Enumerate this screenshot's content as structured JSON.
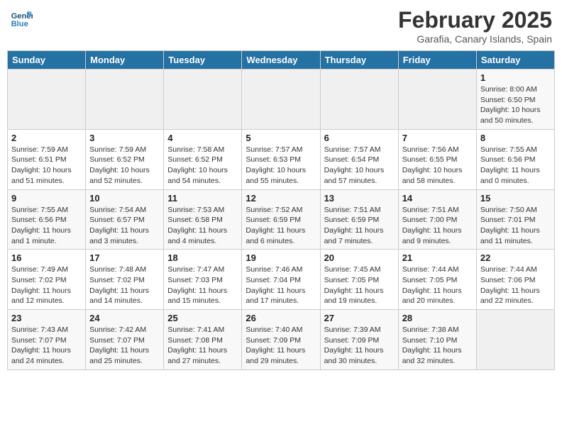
{
  "header": {
    "logo_line1": "General",
    "logo_line2": "Blue",
    "month": "February 2025",
    "location": "Garafia, Canary Islands, Spain"
  },
  "weekdays": [
    "Sunday",
    "Monday",
    "Tuesday",
    "Wednesday",
    "Thursday",
    "Friday",
    "Saturday"
  ],
  "weeks": [
    [
      {
        "day": "",
        "info": ""
      },
      {
        "day": "",
        "info": ""
      },
      {
        "day": "",
        "info": ""
      },
      {
        "day": "",
        "info": ""
      },
      {
        "day": "",
        "info": ""
      },
      {
        "day": "",
        "info": ""
      },
      {
        "day": "1",
        "info": "Sunrise: 8:00 AM\nSunset: 6:50 PM\nDaylight: 10 hours\nand 50 minutes."
      }
    ],
    [
      {
        "day": "2",
        "info": "Sunrise: 7:59 AM\nSunset: 6:51 PM\nDaylight: 10 hours\nand 51 minutes."
      },
      {
        "day": "3",
        "info": "Sunrise: 7:59 AM\nSunset: 6:52 PM\nDaylight: 10 hours\nand 52 minutes."
      },
      {
        "day": "4",
        "info": "Sunrise: 7:58 AM\nSunset: 6:52 PM\nDaylight: 10 hours\nand 54 minutes."
      },
      {
        "day": "5",
        "info": "Sunrise: 7:57 AM\nSunset: 6:53 PM\nDaylight: 10 hours\nand 55 minutes."
      },
      {
        "day": "6",
        "info": "Sunrise: 7:57 AM\nSunset: 6:54 PM\nDaylight: 10 hours\nand 57 minutes."
      },
      {
        "day": "7",
        "info": "Sunrise: 7:56 AM\nSunset: 6:55 PM\nDaylight: 10 hours\nand 58 minutes."
      },
      {
        "day": "8",
        "info": "Sunrise: 7:55 AM\nSunset: 6:56 PM\nDaylight: 11 hours\nand 0 minutes."
      }
    ],
    [
      {
        "day": "9",
        "info": "Sunrise: 7:55 AM\nSunset: 6:56 PM\nDaylight: 11 hours\nand 1 minute."
      },
      {
        "day": "10",
        "info": "Sunrise: 7:54 AM\nSunset: 6:57 PM\nDaylight: 11 hours\nand 3 minutes."
      },
      {
        "day": "11",
        "info": "Sunrise: 7:53 AM\nSunset: 6:58 PM\nDaylight: 11 hours\nand 4 minutes."
      },
      {
        "day": "12",
        "info": "Sunrise: 7:52 AM\nSunset: 6:59 PM\nDaylight: 11 hours\nand 6 minutes."
      },
      {
        "day": "13",
        "info": "Sunrise: 7:51 AM\nSunset: 6:59 PM\nDaylight: 11 hours\nand 7 minutes."
      },
      {
        "day": "14",
        "info": "Sunrise: 7:51 AM\nSunset: 7:00 PM\nDaylight: 11 hours\nand 9 minutes."
      },
      {
        "day": "15",
        "info": "Sunrise: 7:50 AM\nSunset: 7:01 PM\nDaylight: 11 hours\nand 11 minutes."
      }
    ],
    [
      {
        "day": "16",
        "info": "Sunrise: 7:49 AM\nSunset: 7:02 PM\nDaylight: 11 hours\nand 12 minutes."
      },
      {
        "day": "17",
        "info": "Sunrise: 7:48 AM\nSunset: 7:02 PM\nDaylight: 11 hours\nand 14 minutes."
      },
      {
        "day": "18",
        "info": "Sunrise: 7:47 AM\nSunset: 7:03 PM\nDaylight: 11 hours\nand 15 minutes."
      },
      {
        "day": "19",
        "info": "Sunrise: 7:46 AM\nSunset: 7:04 PM\nDaylight: 11 hours\nand 17 minutes."
      },
      {
        "day": "20",
        "info": "Sunrise: 7:45 AM\nSunset: 7:05 PM\nDaylight: 11 hours\nand 19 minutes."
      },
      {
        "day": "21",
        "info": "Sunrise: 7:44 AM\nSunset: 7:05 PM\nDaylight: 11 hours\nand 20 minutes."
      },
      {
        "day": "22",
        "info": "Sunrise: 7:44 AM\nSunset: 7:06 PM\nDaylight: 11 hours\nand 22 minutes."
      }
    ],
    [
      {
        "day": "23",
        "info": "Sunrise: 7:43 AM\nSunset: 7:07 PM\nDaylight: 11 hours\nand 24 minutes."
      },
      {
        "day": "24",
        "info": "Sunrise: 7:42 AM\nSunset: 7:07 PM\nDaylight: 11 hours\nand 25 minutes."
      },
      {
        "day": "25",
        "info": "Sunrise: 7:41 AM\nSunset: 7:08 PM\nDaylight: 11 hours\nand 27 minutes."
      },
      {
        "day": "26",
        "info": "Sunrise: 7:40 AM\nSunset: 7:09 PM\nDaylight: 11 hours\nand 29 minutes."
      },
      {
        "day": "27",
        "info": "Sunrise: 7:39 AM\nSunset: 7:09 PM\nDaylight: 11 hours\nand 30 minutes."
      },
      {
        "day": "28",
        "info": "Sunrise: 7:38 AM\nSunset: 7:10 PM\nDaylight: 11 hours\nand 32 minutes."
      },
      {
        "day": "",
        "info": ""
      }
    ]
  ]
}
